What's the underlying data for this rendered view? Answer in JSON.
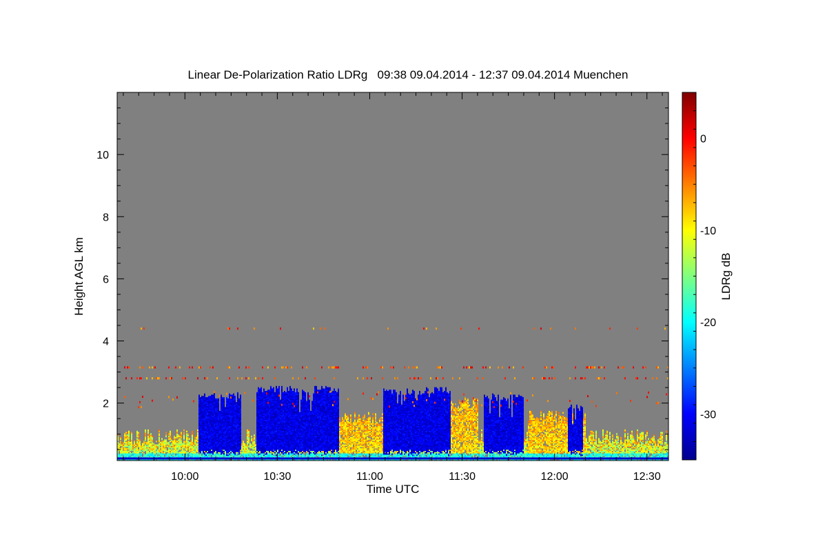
{
  "chart_data": {
    "type": "heatmap",
    "title": "Linear De-Polarization Ratio LDRg   09:38 09.04.2014 - 12:37 09.04.2014 Muenchen",
    "xlabel": "Time UTC",
    "ylabel": "Height AGL km",
    "colorbar_label": "LDRg dB",
    "x_range": [
      "09:38",
      "12:37"
    ],
    "x_ticks": [
      "10:00",
      "10:30",
      "11:00",
      "11:30",
      "12:00",
      "12:30"
    ],
    "ylim": [
      0.15,
      12
    ],
    "y_ticks": [
      2,
      4,
      6,
      8,
      10
    ],
    "colorbar_range": [
      -35,
      5
    ],
    "colorbar_ticks": [
      0,
      -10,
      -20,
      -30
    ],
    "colormap": "jet",
    "background_color": "#808080",
    "blue_cloud_segments": [
      {
        "start": "10:04",
        "end": "10:18",
        "top_km": 2.35
      },
      {
        "start": "10:23",
        "end": "10:50",
        "top_km": 2.55
      },
      {
        "start": "11:04",
        "end": "11:26",
        "top_km": 2.5
      },
      {
        "start": "11:37",
        "end": "11:50",
        "top_km": 2.3
      },
      {
        "start": "12:04",
        "end": "12:09",
        "top_km": 1.95
      }
    ],
    "high_ldr_regions": [
      {
        "start": "10:50",
        "end": "11:06",
        "top_km": 1.7
      },
      {
        "start": "11:26",
        "end": "11:35",
        "top_km": 2.2
      },
      {
        "start": "11:51",
        "end": "12:10",
        "top_km": 1.8
      }
    ],
    "sparse_layers_km": [
      4.4,
      3.15,
      2.8
    ]
  }
}
